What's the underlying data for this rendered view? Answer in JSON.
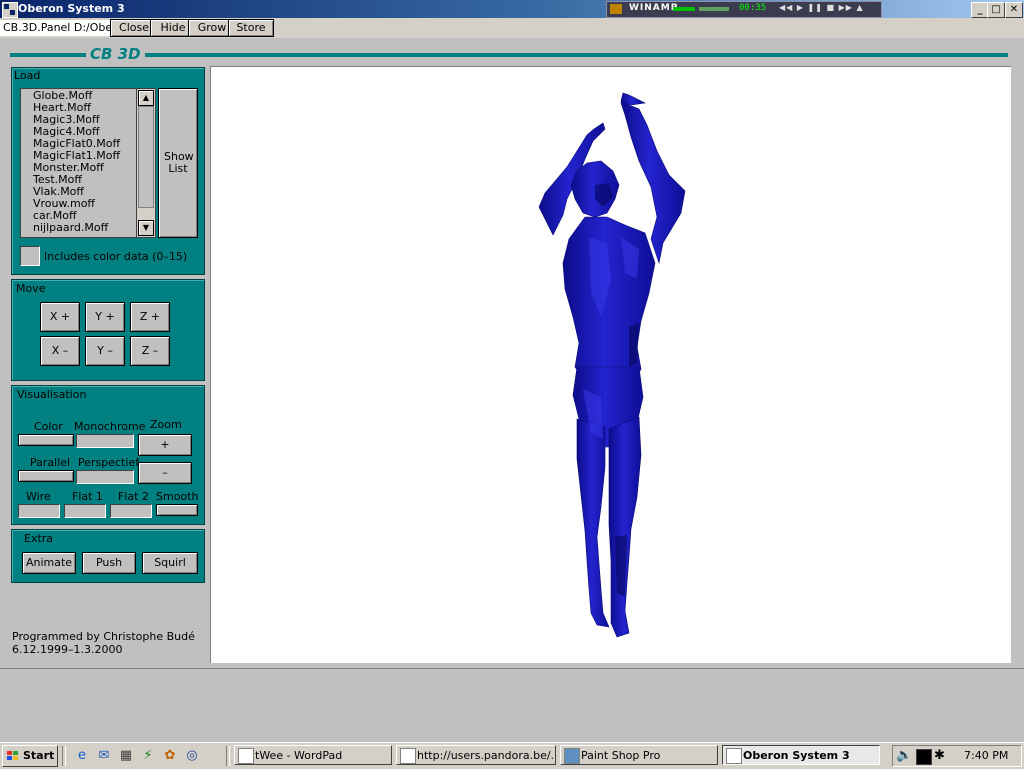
{
  "window": {
    "title": "Oberon System 3",
    "minimize": "_",
    "maximize": "□",
    "close": "✕"
  },
  "winamp": {
    "label": "WINAMP",
    "time": "00:35",
    "controls": "◀◀ ▶ ❚❚ ■ ▶▶ ▲"
  },
  "menu": {
    "panel_title": "CB.3D.Panel D:/Obe",
    "buttons": [
      "Close",
      "Hide",
      "Grow",
      "Store"
    ]
  },
  "header": {
    "title": "CB 3D"
  },
  "load": {
    "label": "Load",
    "files": [
      "Globe.Moff",
      "Heart.Moff",
      "Magic3.Moff",
      "Magic4.Moff",
      "MagicFlat0.Moff",
      "MagicFlat1.Moff",
      "Monster.Moff",
      "Test.Moff",
      "Vlak.Moff",
      "Vrouw.moff",
      "car.Moff",
      "nijlpaard.Moff"
    ],
    "show_list": "Show List",
    "include_color": "Includes color data (0–15)"
  },
  "move": {
    "label": "Move",
    "buttons": [
      "X +",
      "Y +",
      "Z +",
      "X –",
      "Y –",
      "Z –"
    ]
  },
  "visualisation": {
    "label": "Visualisation",
    "color": "Color",
    "monochrome": "Monochrome",
    "zoom": "Zoom",
    "zoom_in": "+",
    "zoom_out": "–",
    "parallel": "Parallel",
    "perspectief": "Perspectief",
    "wire": "Wire",
    "flat1": "Flat 1",
    "flat2": "Flat 2",
    "smooth": "Smooth"
  },
  "extra": {
    "label": "Extra",
    "buttons": [
      "Animate",
      "Push",
      "Squirl"
    ]
  },
  "credits": {
    "line1": "Programmed by  Christophe Budé",
    "line2": "6.12.1999–1.3.2000"
  },
  "colors": {
    "teal": "#008080",
    "figure": "#1a1ab8",
    "titlebar": "#0a246a"
  },
  "taskbar": {
    "start": "Start",
    "tasks": [
      "tWee - WordPad",
      "http://users.pandora.be/...",
      "Paint Shop Pro",
      "Oberon System 3"
    ],
    "clock": "7:40 PM"
  }
}
